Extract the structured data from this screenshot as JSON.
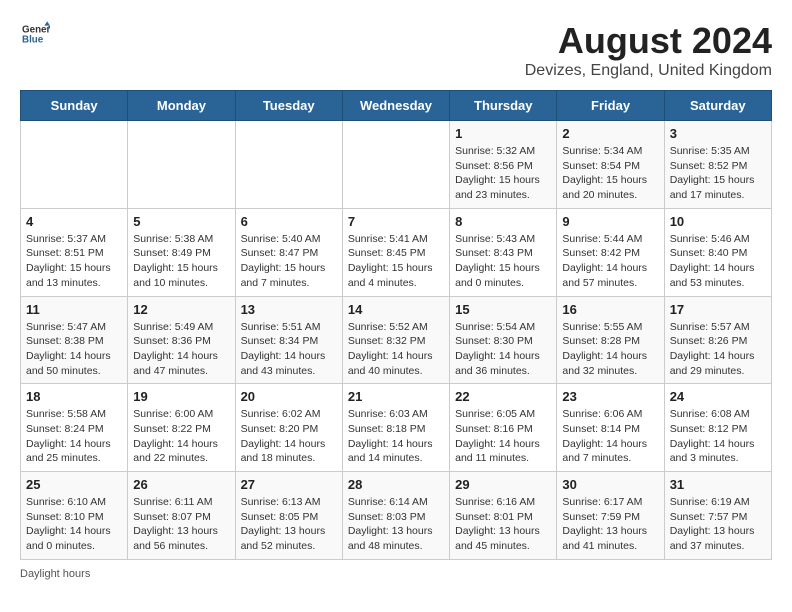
{
  "header": {
    "logo_general": "General",
    "logo_blue": "Blue",
    "title": "August 2024",
    "subtitle": "Devizes, England, United Kingdom"
  },
  "days_of_week": [
    "Sunday",
    "Monday",
    "Tuesday",
    "Wednesday",
    "Thursday",
    "Friday",
    "Saturday"
  ],
  "weeks": [
    [
      {
        "day": "",
        "info": ""
      },
      {
        "day": "",
        "info": ""
      },
      {
        "day": "",
        "info": ""
      },
      {
        "day": "",
        "info": ""
      },
      {
        "day": "1",
        "info": "Sunrise: 5:32 AM\nSunset: 8:56 PM\nDaylight: 15 hours\nand 23 minutes."
      },
      {
        "day": "2",
        "info": "Sunrise: 5:34 AM\nSunset: 8:54 PM\nDaylight: 15 hours\nand 20 minutes."
      },
      {
        "day": "3",
        "info": "Sunrise: 5:35 AM\nSunset: 8:52 PM\nDaylight: 15 hours\nand 17 minutes."
      }
    ],
    [
      {
        "day": "4",
        "info": "Sunrise: 5:37 AM\nSunset: 8:51 PM\nDaylight: 15 hours\nand 13 minutes."
      },
      {
        "day": "5",
        "info": "Sunrise: 5:38 AM\nSunset: 8:49 PM\nDaylight: 15 hours\nand 10 minutes."
      },
      {
        "day": "6",
        "info": "Sunrise: 5:40 AM\nSunset: 8:47 PM\nDaylight: 15 hours\nand 7 minutes."
      },
      {
        "day": "7",
        "info": "Sunrise: 5:41 AM\nSunset: 8:45 PM\nDaylight: 15 hours\nand 4 minutes."
      },
      {
        "day": "8",
        "info": "Sunrise: 5:43 AM\nSunset: 8:43 PM\nDaylight: 15 hours\nand 0 minutes."
      },
      {
        "day": "9",
        "info": "Sunrise: 5:44 AM\nSunset: 8:42 PM\nDaylight: 14 hours\nand 57 minutes."
      },
      {
        "day": "10",
        "info": "Sunrise: 5:46 AM\nSunset: 8:40 PM\nDaylight: 14 hours\nand 53 minutes."
      }
    ],
    [
      {
        "day": "11",
        "info": "Sunrise: 5:47 AM\nSunset: 8:38 PM\nDaylight: 14 hours\nand 50 minutes."
      },
      {
        "day": "12",
        "info": "Sunrise: 5:49 AM\nSunset: 8:36 PM\nDaylight: 14 hours\nand 47 minutes."
      },
      {
        "day": "13",
        "info": "Sunrise: 5:51 AM\nSunset: 8:34 PM\nDaylight: 14 hours\nand 43 minutes."
      },
      {
        "day": "14",
        "info": "Sunrise: 5:52 AM\nSunset: 8:32 PM\nDaylight: 14 hours\nand 40 minutes."
      },
      {
        "day": "15",
        "info": "Sunrise: 5:54 AM\nSunset: 8:30 PM\nDaylight: 14 hours\nand 36 minutes."
      },
      {
        "day": "16",
        "info": "Sunrise: 5:55 AM\nSunset: 8:28 PM\nDaylight: 14 hours\nand 32 minutes."
      },
      {
        "day": "17",
        "info": "Sunrise: 5:57 AM\nSunset: 8:26 PM\nDaylight: 14 hours\nand 29 minutes."
      }
    ],
    [
      {
        "day": "18",
        "info": "Sunrise: 5:58 AM\nSunset: 8:24 PM\nDaylight: 14 hours\nand 25 minutes."
      },
      {
        "day": "19",
        "info": "Sunrise: 6:00 AM\nSunset: 8:22 PM\nDaylight: 14 hours\nand 22 minutes."
      },
      {
        "day": "20",
        "info": "Sunrise: 6:02 AM\nSunset: 8:20 PM\nDaylight: 14 hours\nand 18 minutes."
      },
      {
        "day": "21",
        "info": "Sunrise: 6:03 AM\nSunset: 8:18 PM\nDaylight: 14 hours\nand 14 minutes."
      },
      {
        "day": "22",
        "info": "Sunrise: 6:05 AM\nSunset: 8:16 PM\nDaylight: 14 hours\nand 11 minutes."
      },
      {
        "day": "23",
        "info": "Sunrise: 6:06 AM\nSunset: 8:14 PM\nDaylight: 14 hours\nand 7 minutes."
      },
      {
        "day": "24",
        "info": "Sunrise: 6:08 AM\nSunset: 8:12 PM\nDaylight: 14 hours\nand 3 minutes."
      }
    ],
    [
      {
        "day": "25",
        "info": "Sunrise: 6:10 AM\nSunset: 8:10 PM\nDaylight: 14 hours\nand 0 minutes."
      },
      {
        "day": "26",
        "info": "Sunrise: 6:11 AM\nSunset: 8:07 PM\nDaylight: 13 hours\nand 56 minutes."
      },
      {
        "day": "27",
        "info": "Sunrise: 6:13 AM\nSunset: 8:05 PM\nDaylight: 13 hours\nand 52 minutes."
      },
      {
        "day": "28",
        "info": "Sunrise: 6:14 AM\nSunset: 8:03 PM\nDaylight: 13 hours\nand 48 minutes."
      },
      {
        "day": "29",
        "info": "Sunrise: 6:16 AM\nSunset: 8:01 PM\nDaylight: 13 hours\nand 45 minutes."
      },
      {
        "day": "30",
        "info": "Sunrise: 6:17 AM\nSunset: 7:59 PM\nDaylight: 13 hours\nand 41 minutes."
      },
      {
        "day": "31",
        "info": "Sunrise: 6:19 AM\nSunset: 7:57 PM\nDaylight: 13 hours\nand 37 minutes."
      }
    ]
  ],
  "footer": {
    "note": "Daylight hours"
  }
}
